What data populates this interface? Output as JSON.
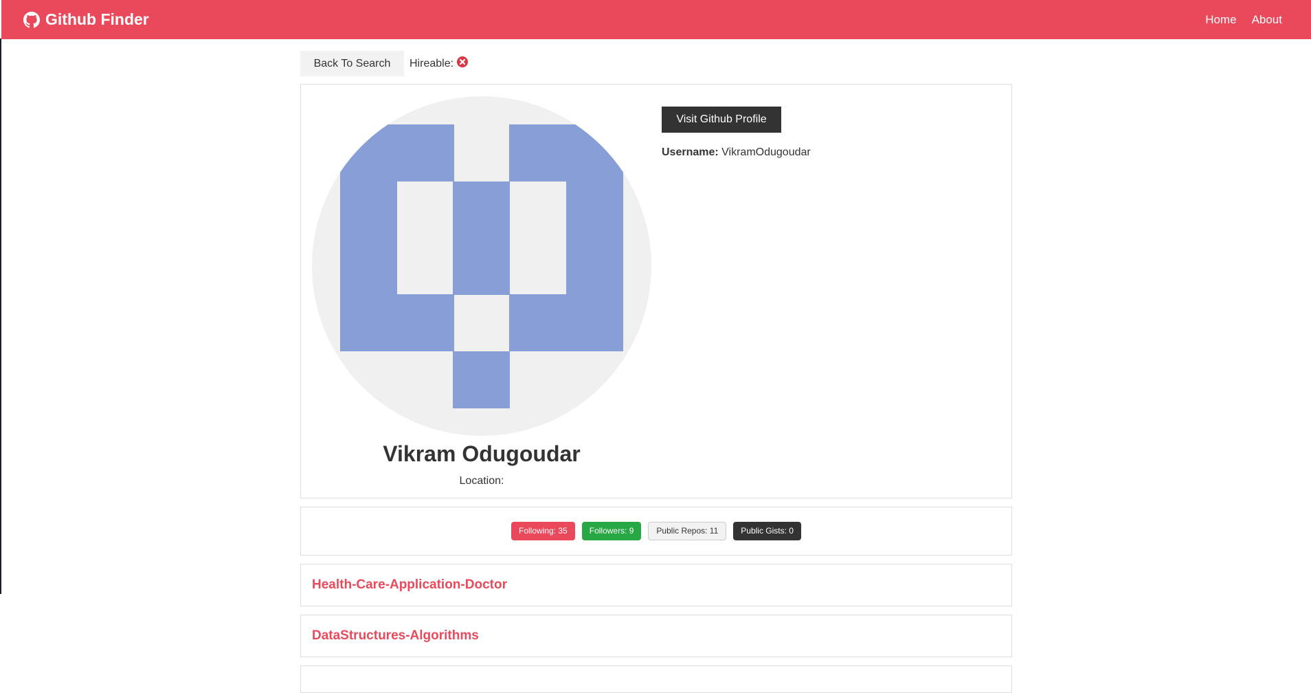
{
  "navbar": {
    "brand": "Github Finder",
    "links": [
      "Home",
      "About"
    ]
  },
  "topbar": {
    "back_label": "Back To Search",
    "hireable_label": "Hireable:"
  },
  "profile": {
    "name": "Vikram Odugoudar",
    "location_label": "Location:",
    "visit_label": "Visit Github Profile",
    "username_label": "Username:",
    "username": "VikramOdugoudar"
  },
  "stats": {
    "following": "Following: 35",
    "followers": "Followers: 9",
    "public_repos": "Public Repos: 11",
    "public_gists": "Public Gists: 0"
  },
  "repos": [
    "Health-Care-Application-Doctor",
    "DataStructures-Algorithms"
  ],
  "colors": {
    "brand": "#e9495b",
    "avatar_fill": "#879fd6",
    "followers_badge": "#28a745",
    "dark": "#333333"
  },
  "icons": {
    "brand": "github-icon",
    "hireable": "x-circle-icon"
  }
}
